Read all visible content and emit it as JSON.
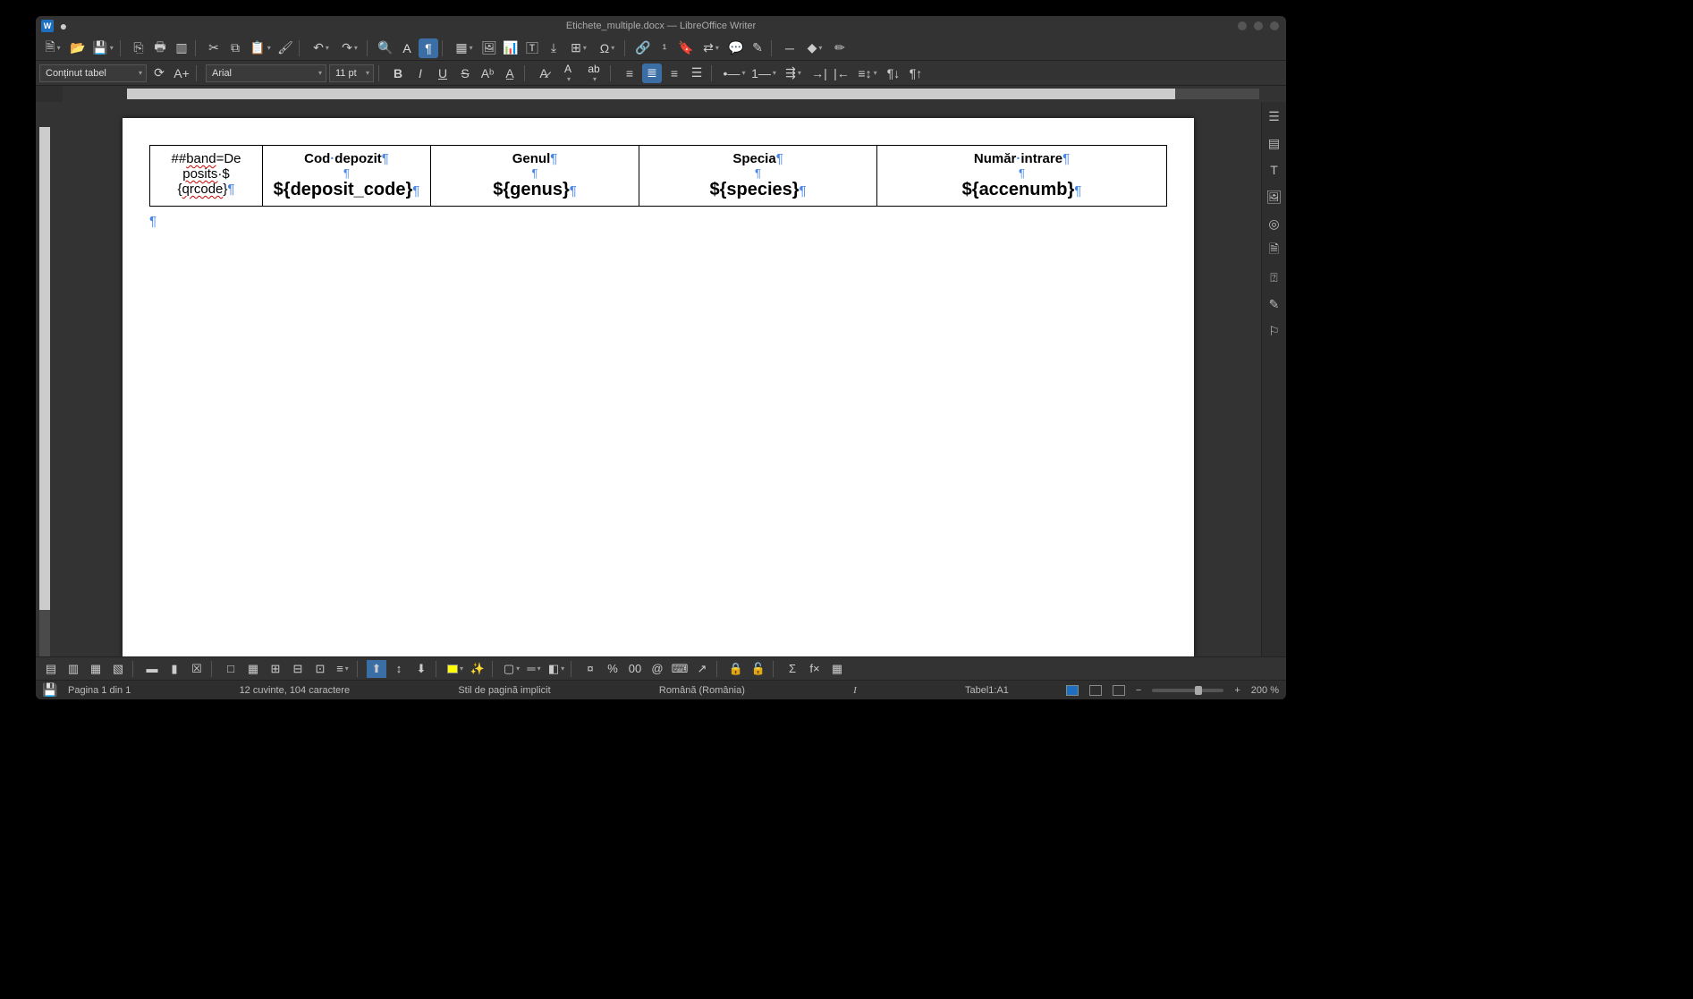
{
  "window": {
    "title": "Etichete_multiple.docx — LibreOffice Writer"
  },
  "format": {
    "paragraph_style": "Conținut tabel",
    "font_name": "Arial",
    "font_size": "11 pt"
  },
  "document": {
    "para_mark": "¶",
    "table": {
      "cell1": {
        "line1_a": "##",
        "line1_b": "band",
        "line1_c": "=De",
        "line2_a": "posits",
        "line2_b": "·$",
        "line3_a": "{",
        "line3_b": "qrcode",
        "line3_c": "}"
      },
      "columns": [
        {
          "header_a": "Cod",
          "header_sep": "·",
          "header_b": "depozit",
          "value": "${deposit_code}"
        },
        {
          "header": "Genul",
          "value": "${genus}"
        },
        {
          "header": "Specia",
          "value": "${species}"
        },
        {
          "header_a": "Număr",
          "header_sep": "·",
          "header_b": "intrare",
          "value": "${accenumb}"
        }
      ]
    }
  },
  "status": {
    "page": "Pagina 1 din 1",
    "words": "12 cuvinte, 104 caractere",
    "style": "Stil de pagină implicit",
    "language": "Română (România)",
    "table_pos": "Tabel1:A1",
    "zoom": "200 %"
  }
}
